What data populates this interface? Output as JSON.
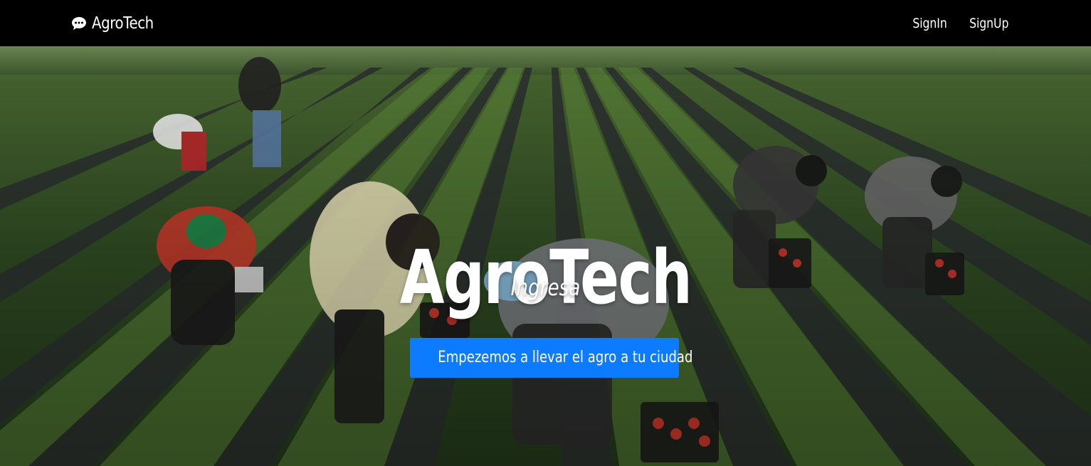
{
  "navbar": {
    "brand_name": "AgroTech",
    "brand_icon": "chat-bubble-icon",
    "links": {
      "signin_label": "SignIn",
      "signup_label": "SignUp"
    }
  },
  "hero": {
    "title": "AgroTech",
    "subtitle": "Ingresa",
    "cta_label": "Empezemos a llevar el agro a tu ciudad",
    "background_image": "strawberry-field-workers-photo"
  },
  "colors": {
    "navbar_bg": "#000000",
    "cta_bg": "#0d7bfd",
    "text": "#ffffff"
  }
}
